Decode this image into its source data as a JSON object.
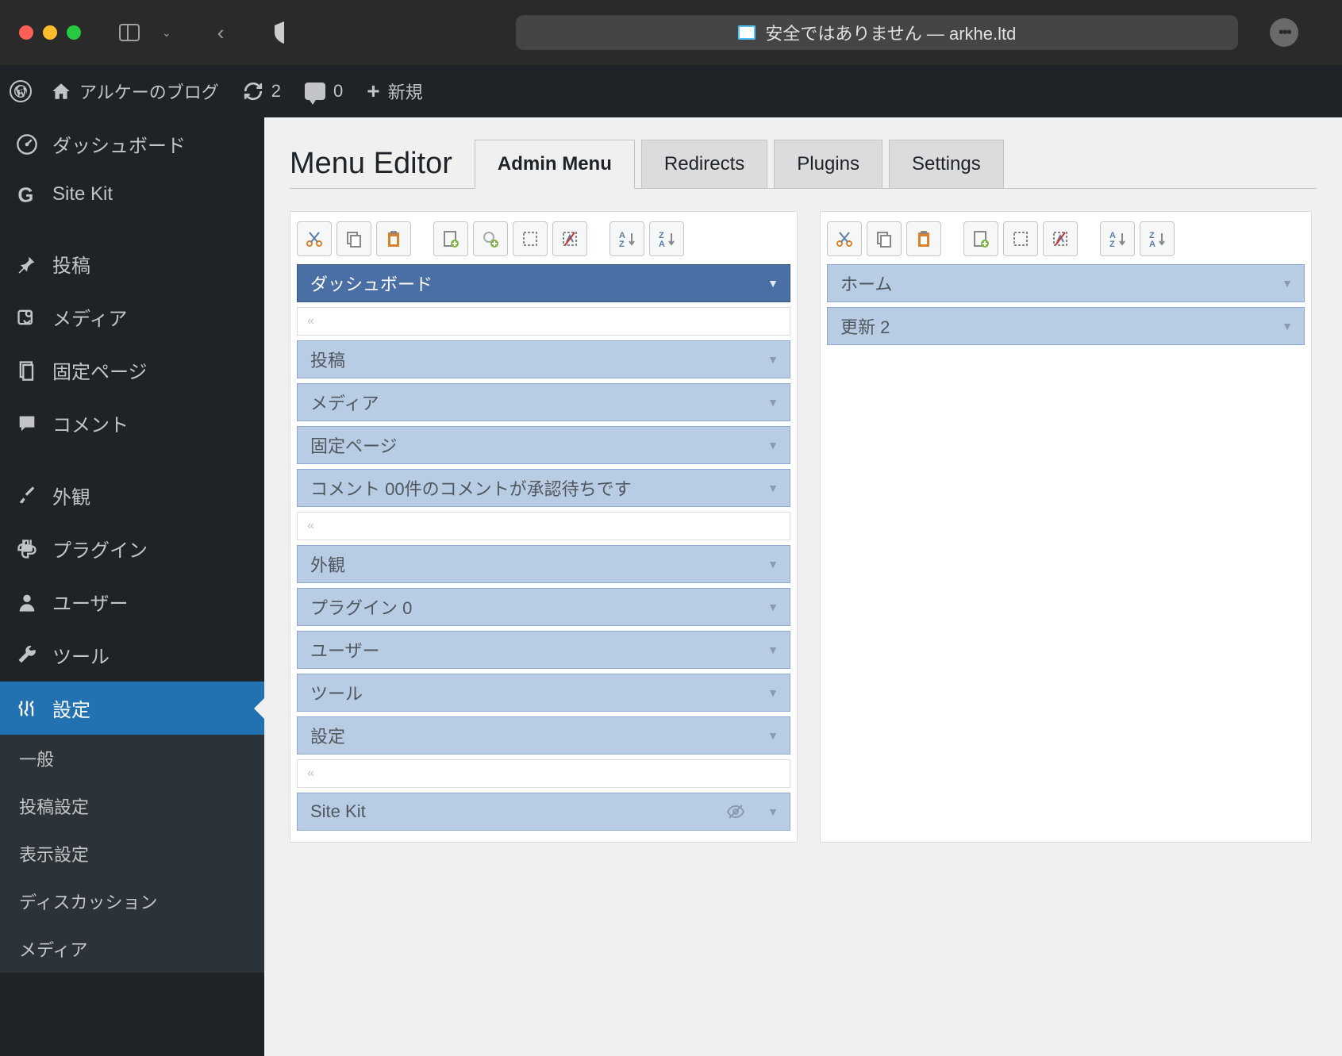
{
  "browser": {
    "address_text": "安全ではありません — arkhe.ltd"
  },
  "adminbar": {
    "site_name": "アルケーのブログ",
    "updates_count": "2",
    "comments_count": "0",
    "new_label": "新規"
  },
  "sidebar": {
    "items": [
      {
        "label": "ダッシュボード",
        "icon": "dashboard"
      },
      {
        "label": "Site Kit",
        "icon": "sitekit"
      },
      {
        "label": "投稿",
        "icon": "pin"
      },
      {
        "label": "メディア",
        "icon": "media"
      },
      {
        "label": "固定ページ",
        "icon": "page"
      },
      {
        "label": "コメント",
        "icon": "comment"
      },
      {
        "label": "外観",
        "icon": "brush"
      },
      {
        "label": "プラグイン",
        "icon": "plugin"
      },
      {
        "label": "ユーザー",
        "icon": "user"
      },
      {
        "label": "ツール",
        "icon": "wrench"
      },
      {
        "label": "設定",
        "icon": "settings"
      }
    ],
    "submenu": [
      {
        "label": "一般"
      },
      {
        "label": "投稿設定"
      },
      {
        "label": "表示設定"
      },
      {
        "label": "ディスカッション"
      },
      {
        "label": "メディア"
      }
    ]
  },
  "page": {
    "title": "Menu Editor",
    "tabs": [
      {
        "label": "Admin Menu"
      },
      {
        "label": "Redirects"
      },
      {
        "label": "Plugins"
      },
      {
        "label": "Settings"
      }
    ]
  },
  "editor": {
    "left_items": [
      {
        "type": "item",
        "label": "ダッシュボード",
        "selected": true
      },
      {
        "type": "separator"
      },
      {
        "type": "item",
        "label": "投稿"
      },
      {
        "type": "item",
        "label": "メディア"
      },
      {
        "type": "item",
        "label": "固定ページ"
      },
      {
        "type": "item",
        "label": "コメント 00件のコメントが承認待ちです"
      },
      {
        "type": "separator"
      },
      {
        "type": "item",
        "label": "外観"
      },
      {
        "type": "item",
        "label": "プラグイン 0"
      },
      {
        "type": "item",
        "label": "ユーザー"
      },
      {
        "type": "item",
        "label": "ツール"
      },
      {
        "type": "item",
        "label": "設定"
      },
      {
        "type": "separator"
      },
      {
        "type": "item",
        "label": "Site Kit",
        "hidden_icon": true
      }
    ],
    "right_items": [
      {
        "type": "item",
        "label": "ホーム"
      },
      {
        "type": "item",
        "label": "更新 2"
      }
    ]
  }
}
